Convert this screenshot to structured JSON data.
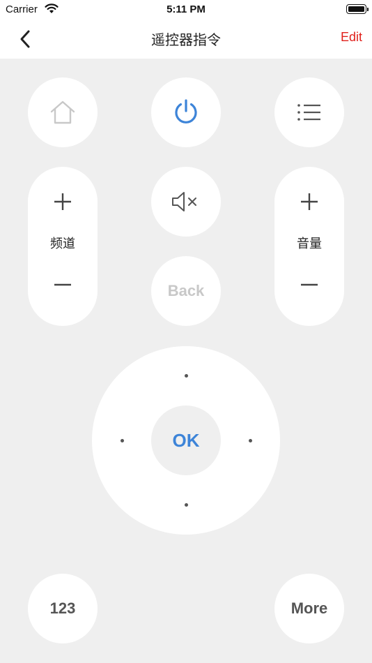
{
  "status_bar": {
    "carrier": "Carrier",
    "time": "5:11 PM"
  },
  "nav": {
    "title": "遥控器指令",
    "edit_label": "Edit",
    "back_icon": "chevron-left-icon"
  },
  "remote": {
    "home_icon": "home-icon",
    "power_icon": "power-icon",
    "menu_icon": "menu-list-icon",
    "mute_icon": "mute-icon",
    "channel": {
      "label": "频道",
      "up_icon": "plus-icon",
      "down_icon": "minus-icon"
    },
    "volume": {
      "label": "音量",
      "up_icon": "plus-icon",
      "down_icon": "minus-icon"
    },
    "back_label": "Back",
    "ok_label": "OK",
    "numpad_label": "123",
    "more_label": "More"
  },
  "colors": {
    "accent": "#3d84d8",
    "edit": "#e0201b",
    "background": "#efefef",
    "button": "#ffffff",
    "disabled": "#c8c8c8"
  }
}
